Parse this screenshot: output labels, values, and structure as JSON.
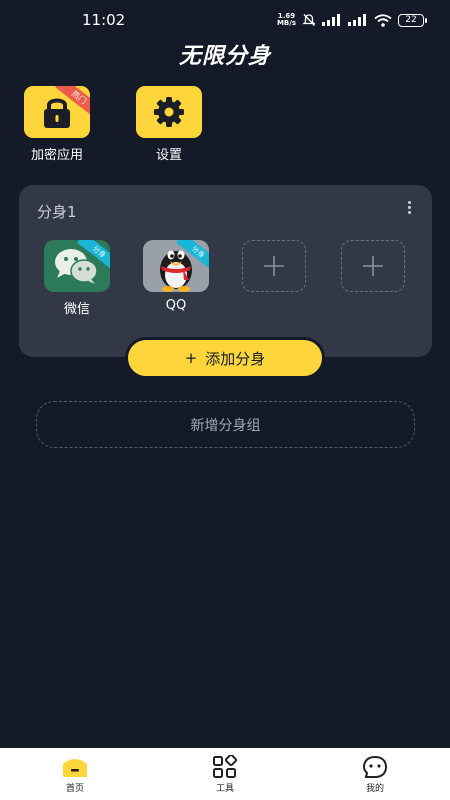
{
  "status_bar": {
    "time": "11:02",
    "net_speed_value": "1.69",
    "net_speed_unit": "MB/s",
    "battery": "22",
    "icons": [
      "mute-icon",
      "signal-icon",
      "signal-icon",
      "wifi-icon",
      "battery-icon"
    ]
  },
  "header": {
    "title": "无限分身"
  },
  "tiles": [
    {
      "label": "加密应用",
      "icon": "lock-icon",
      "ribbon": "热门"
    },
    {
      "label": "设置",
      "icon": "gear-icon"
    }
  ],
  "group": {
    "title": "分身1",
    "apps": [
      {
        "name": "微信",
        "icon": "wechat-icon",
        "badge": "分身"
      },
      {
        "name": "QQ",
        "icon": "qq-penguin-icon",
        "badge": "分身"
      }
    ],
    "empty_slot_icon": "plus-icon"
  },
  "add_clone_button": {
    "label": "添加分身",
    "prefix": "+"
  },
  "new_group_button": {
    "label": "新增分身组"
  },
  "bottom_nav": [
    {
      "label": "首页",
      "icon": "home-icon",
      "active": true
    },
    {
      "label": "工具",
      "icon": "tools-grid-icon",
      "active": false
    },
    {
      "label": "我的",
      "icon": "profile-face-icon",
      "active": false
    }
  ],
  "colors": {
    "background": "#151a29",
    "card": "#333847",
    "accent": "#fed63b",
    "ribbon": "#f05a4a",
    "badge": "#1ab6d6"
  }
}
